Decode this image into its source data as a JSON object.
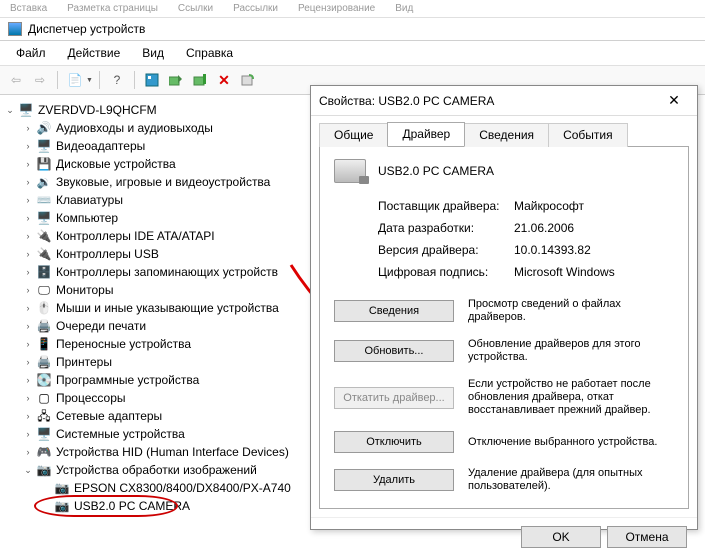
{
  "ribbon": {
    "t1": "Вставка",
    "t2": "Разметка страницы",
    "t3": "Ссылки",
    "t4": "Рассылки",
    "t5": "Рецензирование",
    "t6": "Вид"
  },
  "window": {
    "title": "Диспетчер устройств"
  },
  "menu": {
    "file": "Файл",
    "action": "Действие",
    "view": "Вид",
    "help": "Справка"
  },
  "tree": {
    "root": "ZVERDVD-L9QHCFM",
    "items": [
      "Аудиовходы и аудиовыходы",
      "Видеоадаптеры",
      "Дисковые устройства",
      "Звуковые, игровые и видеоустройства",
      "Клавиатуры",
      "Компьютер",
      "Контроллеры IDE ATA/ATAPI",
      "Контроллеры USB",
      "Контроллеры запоминающих устройств",
      "Мониторы",
      "Мыши и иные указывающие устройства",
      "Очереди печати",
      "Переносные устройства",
      "Принтеры",
      "Программные устройства",
      "Процессоры",
      "Сетевые адаптеры",
      "Системные устройства",
      "Устройства HID (Human Interface Devices)"
    ],
    "imaging": "Устройства обработки изображений",
    "epson": "EPSON CX8300/8400/DX8400/PX-A740",
    "camera": "USB2.0 PC CAMERA"
  },
  "dialog": {
    "title": "Свойства: USB2.0 PC CAMERA",
    "tabs": {
      "general": "Общие",
      "driver": "Драйвер",
      "details": "Сведения",
      "events": "События"
    },
    "device": "USB2.0 PC CAMERA",
    "provider_k": "Поставщик драйвера:",
    "provider_v": "Майкрософт",
    "date_k": "Дата разработки:",
    "date_v": "21.06.2006",
    "ver_k": "Версия драйвера:",
    "ver_v": "10.0.14393.82",
    "sig_k": "Цифровая подпись:",
    "sig_v": "Microsoft Windows",
    "btn_details": "Сведения",
    "desc_details": "Просмотр сведений о файлах драйверов.",
    "btn_update": "Обновить...",
    "desc_update": "Обновление драйверов для этого устройства.",
    "btn_rollback": "Откатить драйвер...",
    "desc_rollback": "Если устройство не работает после обновления драйвера, откат восстанавливает прежний драйвер.",
    "btn_disable": "Отключить",
    "desc_disable": "Отключение выбранного устройства.",
    "btn_remove": "Удалить",
    "desc_remove": "Удаление драйвера (для опытных пользователей).",
    "ok": "OK",
    "cancel": "Отмена"
  }
}
